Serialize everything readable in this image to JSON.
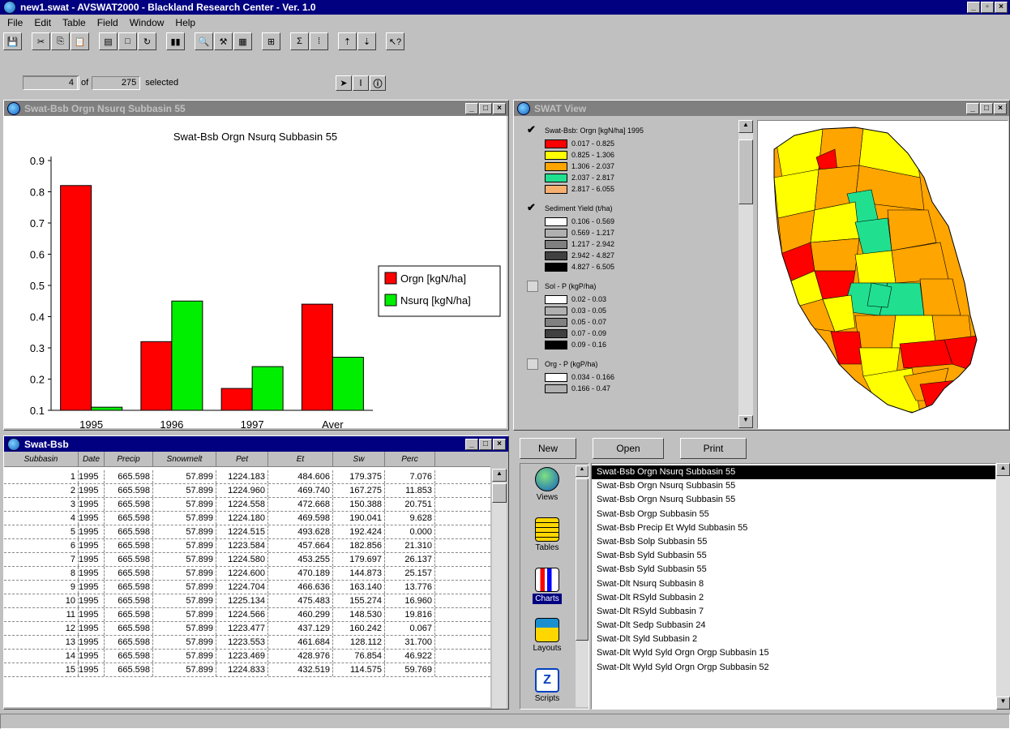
{
  "app": {
    "title": "new1.swat - AVSWAT2000 - Blackland Research Center - Ver. 1.0",
    "menu": [
      "File",
      "Edit",
      "Table",
      "Field",
      "Window",
      "Help"
    ]
  },
  "statusbar": {
    "count": "4",
    "of_label": "of",
    "total": "275",
    "selected_label": "selected"
  },
  "chart_window": {
    "title": "Swat-Bsb Orgn Nsurq Subbasin 55"
  },
  "chart_data": {
    "type": "bar",
    "title": "Swat-Bsb Orgn Nsurq Subbasin 55",
    "categories": [
      "1995",
      "1996",
      "1997",
      "Aver"
    ],
    "series": [
      {
        "name": "Orgn [kgN/ha]",
        "color": "#ff0000",
        "values": [
          0.82,
          0.32,
          0.17,
          0.44
        ]
      },
      {
        "name": "Nsurq [kgN/ha]",
        "color": "#00ee00",
        "values": [
          0.11,
          0.45,
          0.24,
          0.27
        ]
      }
    ],
    "ylim": [
      0.1,
      0.9
    ],
    "yticks": [
      "0.1",
      "0.2",
      "0.3",
      "0.4",
      "0.5",
      "0.6",
      "0.7",
      "0.8",
      "0.9"
    ],
    "legend_position": "right"
  },
  "view_window": {
    "title": "SWAT View",
    "themes": [
      {
        "name": "Swat-Bsb: Orgn   [kgN/ha] 1995",
        "checked": true,
        "classes": [
          {
            "label": "0.017 - 0.825",
            "color": "#ff0000"
          },
          {
            "label": "0.825 - 1.306",
            "color": "#ffff00"
          },
          {
            "label": "1.306 - 2.037",
            "color": "#ffa500"
          },
          {
            "label": "2.037 - 2.817",
            "color": "#20e090"
          },
          {
            "label": "2.817 - 6.055",
            "color": "#f5b070"
          }
        ]
      },
      {
        "name": "Sediment Yield  (t/ha)",
        "checked": true,
        "classes": [
          {
            "label": "0.106 - 0.569",
            "color": "#ffffff"
          },
          {
            "label": "0.569 - 1.217",
            "color": "#b0b0b0"
          },
          {
            "label": "1.217 - 2.942",
            "color": "#808080"
          },
          {
            "label": "2.942 - 4.827",
            "color": "#404040"
          },
          {
            "label": "4.827 - 6.505",
            "color": "#000000"
          }
        ]
      },
      {
        "name": "Sol - P  (kgP/ha)",
        "checked": false,
        "classes": [
          {
            "label": "0.02 - 0.03",
            "color": "#ffffff"
          },
          {
            "label": "0.03 - 0.05",
            "color": "#b0b0b0"
          },
          {
            "label": "0.05 - 0.07",
            "color": "#808080"
          },
          {
            "label": "0.07 - 0.09",
            "color": "#404040"
          },
          {
            "label": "0.09 - 0.16",
            "color": "#000000"
          }
        ]
      },
      {
        "name": "Org - P  (kgP/ha)",
        "checked": false,
        "classes": [
          {
            "label": "0.034 - 0.166",
            "color": "#ffffff"
          },
          {
            "label": "0.166 - 0.47",
            "color": "#b0b0b0"
          }
        ]
      }
    ]
  },
  "table_window": {
    "title": "Swat-Bsb",
    "columns": [
      "Subbasin",
      "Date",
      "Precip",
      "Snowmelt",
      "Pet",
      "Et",
      "Sw",
      "Perc"
    ],
    "rows": [
      [
        "1",
        "1995",
        "665.598",
        "57.899",
        "1224.183",
        "484.606",
        "179.375",
        "7.076"
      ],
      [
        "2",
        "1995",
        "665.598",
        "57.899",
        "1224.960",
        "469.740",
        "167.275",
        "11.853"
      ],
      [
        "3",
        "1995",
        "665.598",
        "57.899",
        "1224.558",
        "472.668",
        "150.388",
        "20.751"
      ],
      [
        "4",
        "1995",
        "665.598",
        "57.899",
        "1224.180",
        "469.598",
        "190.041",
        "9.628"
      ],
      [
        "5",
        "1995",
        "665.598",
        "57.899",
        "1224.515",
        "493.628",
        "192.424",
        "0.000"
      ],
      [
        "6",
        "1995",
        "665.598",
        "57.899",
        "1223.584",
        "457.664",
        "182.856",
        "21.310"
      ],
      [
        "7",
        "1995",
        "665.598",
        "57.899",
        "1224.580",
        "453.255",
        "179.697",
        "26.137"
      ],
      [
        "8",
        "1995",
        "665.598",
        "57.899",
        "1224.600",
        "470.189",
        "144.873",
        "25.157"
      ],
      [
        "9",
        "1995",
        "665.598",
        "57.899",
        "1224.704",
        "466.636",
        "163.140",
        "13.776"
      ],
      [
        "10",
        "1995",
        "665.598",
        "57.899",
        "1225.134",
        "475.483",
        "155.274",
        "16.960"
      ],
      [
        "11",
        "1995",
        "665.598",
        "57.899",
        "1224.566",
        "460.299",
        "148.530",
        "19.816"
      ],
      [
        "12",
        "1995",
        "665.598",
        "57.899",
        "1223.477",
        "437.129",
        "160.242",
        "0.067"
      ],
      [
        "13",
        "1995",
        "665.598",
        "57.899",
        "1223.553",
        "461.684",
        "128.112",
        "31.700"
      ],
      [
        "14",
        "1995",
        "665.598",
        "57.899",
        "1223.469",
        "428.976",
        "76.854",
        "46.922"
      ],
      [
        "15",
        "1995",
        "665.598",
        "57.899",
        "1224.833",
        "432.519",
        "114.575",
        "59.769"
      ]
    ]
  },
  "project": {
    "buttons": [
      "New",
      "Open",
      "Print"
    ],
    "categories": [
      "Views",
      "Tables",
      "Charts",
      "Layouts",
      "Scripts"
    ],
    "selected_category": "Charts",
    "items": [
      "Swat-Bsb Orgn Nsurq Subbasin 55",
      "Swat-Bsb Orgn Nsurq Subbasin 55",
      "Swat-Bsb Orgn Nsurq Subbasin 55",
      "Swat-Bsb Orgp Subbasin 55",
      "Swat-Bsb Precip Et Wyld Subbasin 55",
      "Swat-Bsb Solp Subbasin 55",
      "Swat-Bsb Syld Subbasin 55",
      "Swat-Bsb Syld Subbasin 55",
      "Swat-Dlt Nsurq Subbasin 8",
      "Swat-Dlt RSyld Subbasin 2",
      "Swat-Dlt RSyld Subbasin 7",
      "Swat-Dlt Sedp Subbasin 24",
      "Swat-Dlt Syld Subbasin 2",
      "Swat-Dlt Wyld Syld Orgn Orgp Subbasin 15",
      "Swat-Dlt Wyld Syld Orgn Orgp Subbasin 52"
    ]
  }
}
